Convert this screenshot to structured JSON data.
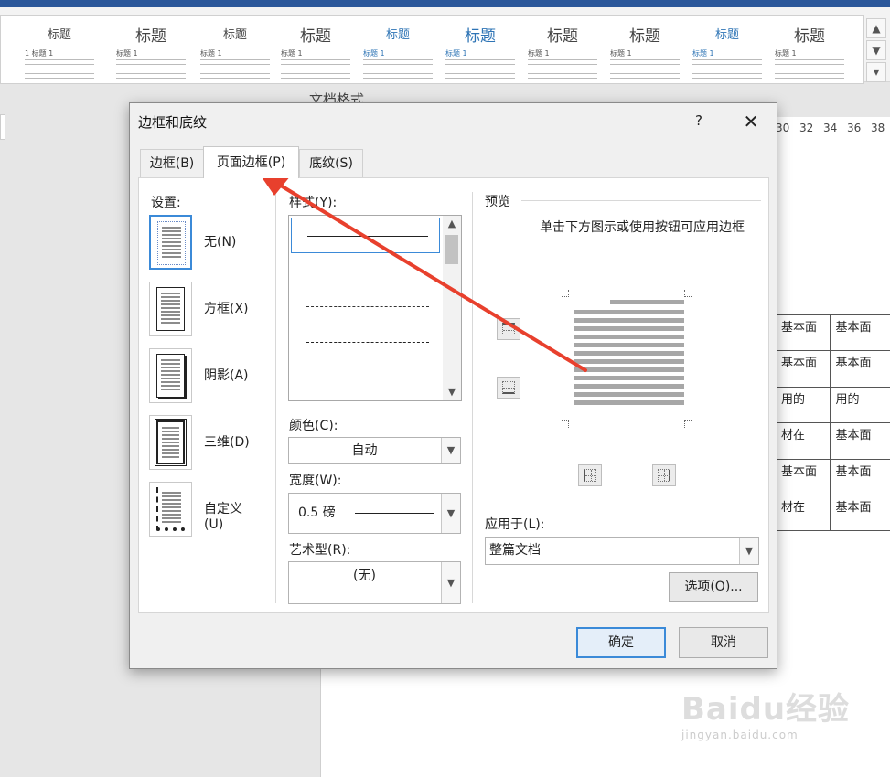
{
  "ribbon": {
    "styles_gallery": [
      {
        "title": "标题",
        "sub": "1 标题 1"
      },
      {
        "title": "标题",
        "sub": "标题 1"
      },
      {
        "title": "标题",
        "sub": "标题 1"
      },
      {
        "title": "标题",
        "sub": "标题 1"
      },
      {
        "title": "标题",
        "sub": "标题 1"
      },
      {
        "title": "标题",
        "sub": "标题 1"
      },
      {
        "title": "标题",
        "sub": "标题 1"
      },
      {
        "title": "标题",
        "sub": "标题 1"
      },
      {
        "title": "标题",
        "sub": "标题 1"
      },
      {
        "title": "标题",
        "sub": "标题 1"
      }
    ],
    "group_label": "文档格式"
  },
  "ruler": {
    "ticks": [
      "30",
      "32",
      "34",
      "36",
      "38"
    ]
  },
  "document_table": [
    [
      "基本面",
      "基本面"
    ],
    [
      "基本面",
      "基本面"
    ],
    [
      "用的",
      "用的"
    ],
    [
      "材在",
      "基本面"
    ],
    [
      "基本面",
      "基本面"
    ],
    [
      "材在",
      "基本面"
    ]
  ],
  "dialog": {
    "title": "边框和底纹",
    "help": "?",
    "close": "✕",
    "tabs": [
      {
        "label": "边框(B)",
        "active": false
      },
      {
        "label": "页面边框(P)",
        "active": true
      },
      {
        "label": "底纹(S)",
        "active": false
      }
    ],
    "settings_label": "设置:",
    "settings": [
      {
        "label": "无(N)",
        "selected": true
      },
      {
        "label": "方框(X)",
        "selected": false
      },
      {
        "label": "阴影(A)",
        "selected": false
      },
      {
        "label": "三维(D)",
        "selected": false
      },
      {
        "label": "自定义(U)",
        "selected": false
      }
    ],
    "style_label": "样式(Y):",
    "color_label": "颜色(C):",
    "color_value": "自动",
    "width_label": "宽度(W):",
    "width_value": "0.5 磅",
    "art_label": "艺术型(R):",
    "art_value": "(无)",
    "preview_label": "预览",
    "preview_hint": "单击下方图示或使用按钮可应用边框",
    "apply_label": "应用于(L):",
    "apply_value": "整篇文档",
    "options_button": "选项(O)...",
    "ok_button": "确定",
    "cancel_button": "取消"
  },
  "annotation": {
    "arrow_color": "#e8402d"
  },
  "watermark": {
    "main": "Baidu经验",
    "sub": "jingyan.baidu.com"
  }
}
